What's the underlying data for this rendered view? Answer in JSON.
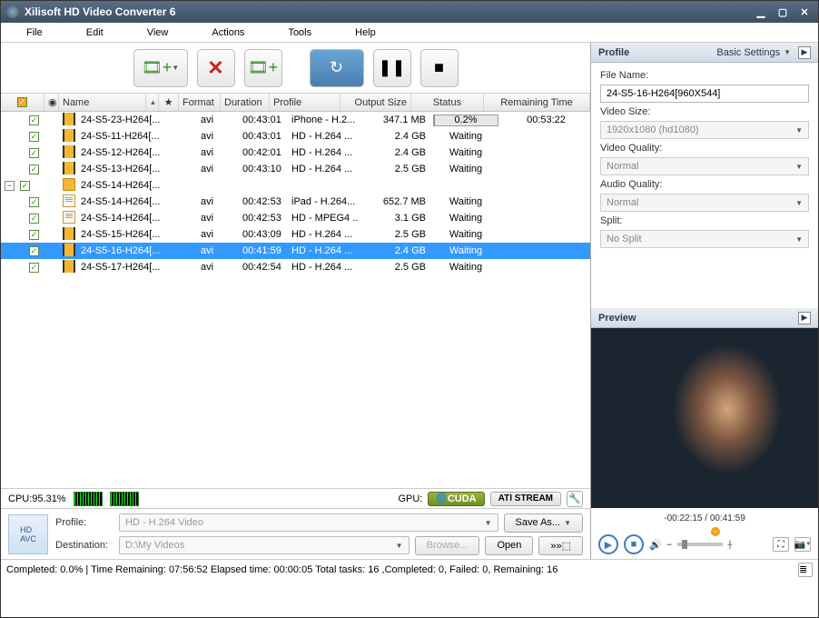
{
  "window": {
    "title": "Xilisoft HD Video Converter 6"
  },
  "menu": {
    "file": "File",
    "edit": "Edit",
    "view": "View",
    "actions": "Actions",
    "tools": "Tools",
    "help": "Help"
  },
  "columns": {
    "name": "Name",
    "format": "Format",
    "duration": "Duration",
    "profile": "Profile",
    "outputSize": "Output Size",
    "status": "Status",
    "remaining": "Remaining Time"
  },
  "rows": [
    {
      "indent": 0,
      "icon": "film",
      "name": "24-S5-23-H264[...",
      "format": "avi",
      "duration": "00:43:01",
      "profile": "iPhone - H.2...",
      "size": "347.1 MB",
      "status": "progress",
      "progress": "0.2%",
      "remaining": "00:53:22"
    },
    {
      "indent": 0,
      "icon": "film",
      "name": "24-S5-11-H264[...",
      "format": "avi",
      "duration": "00:43:01",
      "profile": "HD - H.264 ...",
      "size": "2.4 GB",
      "status": "Waiting",
      "remaining": ""
    },
    {
      "indent": 0,
      "icon": "film",
      "name": "24-S5-12-H264[...",
      "format": "avi",
      "duration": "00:42:01",
      "profile": "HD - H.264 ...",
      "size": "2.4 GB",
      "status": "Waiting",
      "remaining": ""
    },
    {
      "indent": 0,
      "icon": "film",
      "name": "24-S5-13-H264[...",
      "format": "avi",
      "duration": "00:43:10",
      "profile": "HD - H.264 ...",
      "size": "2.5 GB",
      "status": "Waiting",
      "remaining": ""
    },
    {
      "indent": 0,
      "icon": "folder",
      "name": "24-S5-14-H264[...",
      "format": "",
      "duration": "",
      "profile": "",
      "size": "",
      "status": "",
      "remaining": "",
      "expanded": true
    },
    {
      "indent": 1,
      "icon": "doc",
      "name": "24-S5-14-H264[...",
      "format": "avi",
      "duration": "00:42:53",
      "profile": "iPad - H.264...",
      "size": "652.7 MB",
      "status": "Waiting",
      "remaining": ""
    },
    {
      "indent": 1,
      "icon": "doc",
      "name": "24-S5-14-H264[...",
      "format": "avi",
      "duration": "00:42:53",
      "profile": "HD - MPEG4 ...",
      "size": "3.1 GB",
      "status": "Waiting",
      "remaining": ""
    },
    {
      "indent": 0,
      "icon": "film",
      "name": "24-S5-15-H264[...",
      "format": "avi",
      "duration": "00:43:09",
      "profile": "HD - H.264 ...",
      "size": "2.5 GB",
      "status": "Waiting",
      "remaining": ""
    },
    {
      "indent": 0,
      "icon": "film",
      "name": "24-S5-16-H264[...",
      "format": "avi",
      "duration": "00:41:59",
      "profile": "HD - H.264 ...",
      "size": "2.4 GB",
      "status": "Waiting",
      "remaining": "",
      "selected": true
    },
    {
      "indent": 0,
      "icon": "film",
      "name": "24-S5-17-H264[...",
      "format": "avi",
      "duration": "00:42:54",
      "profile": "HD - H.264 ...",
      "size": "2.5 GB",
      "status": "Waiting",
      "remaining": ""
    }
  ],
  "cpu": {
    "label": "CPU:95.31%"
  },
  "gpu": {
    "label": "GPU:",
    "cuda": "CUDA",
    "ati": "ATI STREAM"
  },
  "bottom": {
    "profileLabel": "Profile:",
    "profileValue": "HD - H.264 Video",
    "destLabel": "Destination:",
    "destValue": "D:\\My Videos",
    "saveAs": "Save As...",
    "browse": "Browse...",
    "open": "Open"
  },
  "statusbar": {
    "text": "Completed: 0.0% | Time Remaining: 07:56:52 Elapsed time: 00:00:05 Total tasks: 16 ,Completed: 0, Failed: 0, Remaining: 16"
  },
  "profilePanel": {
    "header": "Profile",
    "basic": "Basic Settings",
    "fileNameLabel": "File Name:",
    "fileNameValue": "24-S5-16-H264[960X544]",
    "videoSizeLabel": "Video Size:",
    "videoSizeValue": "1920x1080 (hd1080)",
    "videoQualityLabel": "Video Quality:",
    "videoQualityValue": "Normal",
    "audioQualityLabel": "Audio Quality:",
    "audioQualityValue": "Normal",
    "splitLabel": "Split:",
    "splitValue": "No Split"
  },
  "preview": {
    "header": "Preview",
    "time": "-00:22:15 / 00:41:59"
  }
}
